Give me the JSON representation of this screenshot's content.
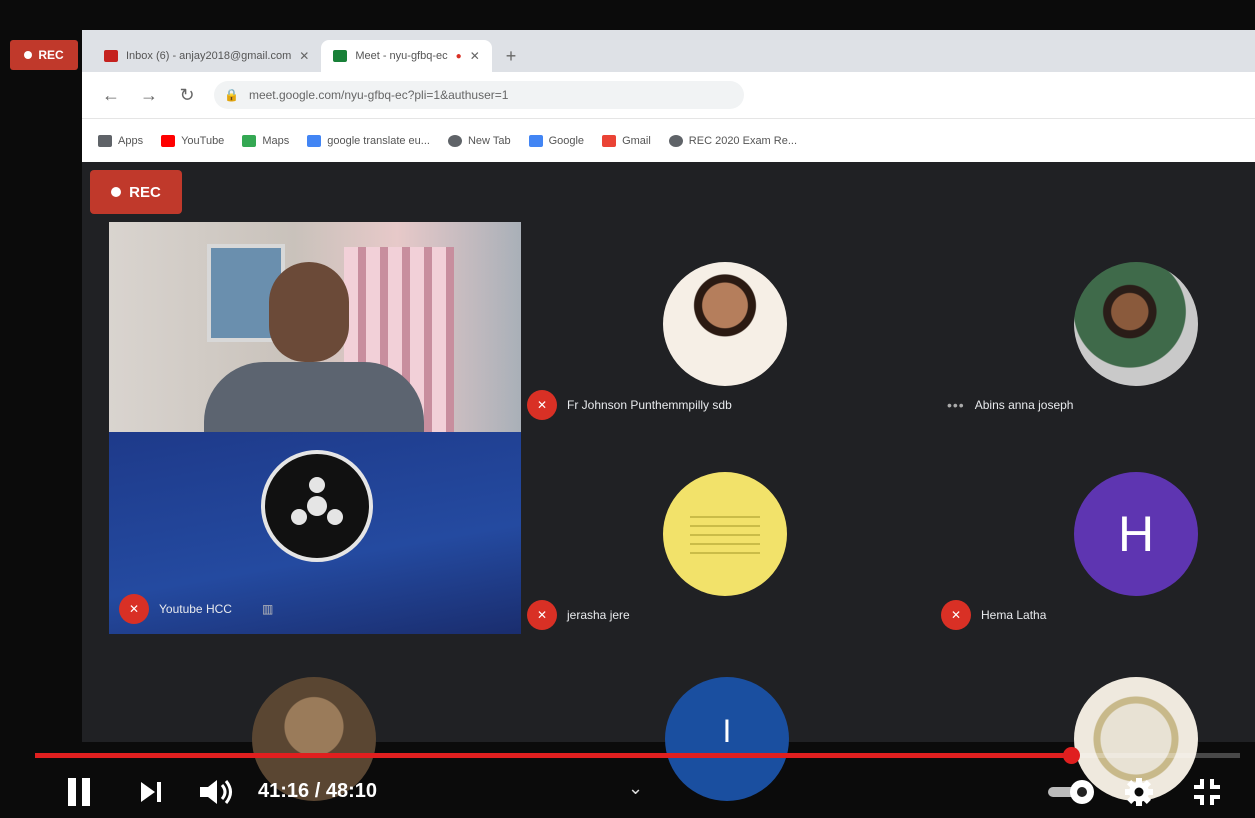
{
  "outer_rec_label": "REC",
  "browser": {
    "tabs": [
      {
        "label": "Inbox (6) - anjay2018@gmail.com",
        "favicon_color": "#c5221f",
        "active": false
      },
      {
        "label": "Meet - nyu-gfbq-ec",
        "favicon_color": "#188038",
        "active": true
      }
    ],
    "new_tab": "+",
    "url": "meet.google.com/nyu-gfbq-ec?pli=1&authuser=1",
    "bookmarks": [
      {
        "label": "Apps",
        "icon": "apps-grid-icon",
        "color": "#5f6368"
      },
      {
        "label": "YouTube",
        "icon": "youtube-icon",
        "color": "#ff0000"
      },
      {
        "label": "Maps",
        "icon": "maps-icon",
        "color": "#34a853"
      },
      {
        "label": "google translate eu...",
        "icon": "translate-icon",
        "color": "#4285f4"
      },
      {
        "label": "New Tab",
        "icon": "globe-icon",
        "color": "#5f6368"
      },
      {
        "label": "Google",
        "icon": "google-icon",
        "color": "#4285f4"
      },
      {
        "label": "Gmail",
        "icon": "gmail-icon",
        "color": "#ea4335"
      },
      {
        "label": "REC 2020 Exam Re...",
        "icon": "globe-icon",
        "color": "#5f6368"
      }
    ]
  },
  "meet": {
    "rec_label": "REC",
    "participants": [
      {
        "name": "Youtube HCC",
        "kind": "video"
      },
      {
        "name": "Fr Johnson Punthemmpilly sdb",
        "kind": "photo"
      },
      {
        "name": "Abins anna joseph",
        "kind": "photo"
      },
      {
        "name": "jerasha jere",
        "kind": "yellow-avatar"
      },
      {
        "name": "Hema Latha",
        "kind": "initial",
        "initial": "H",
        "color": "#5e35b1"
      },
      {
        "name": "",
        "kind": "photo"
      },
      {
        "name": "",
        "kind": "initial",
        "initial": "I",
        "color": "#1a4fa0"
      },
      {
        "name": "",
        "kind": "photo"
      }
    ]
  },
  "player": {
    "current_time": "41:16",
    "duration": "48:10",
    "time_display": "41:16 / 48:10",
    "progress": 0.86,
    "colors": {
      "progress": "#e01f1f"
    }
  }
}
